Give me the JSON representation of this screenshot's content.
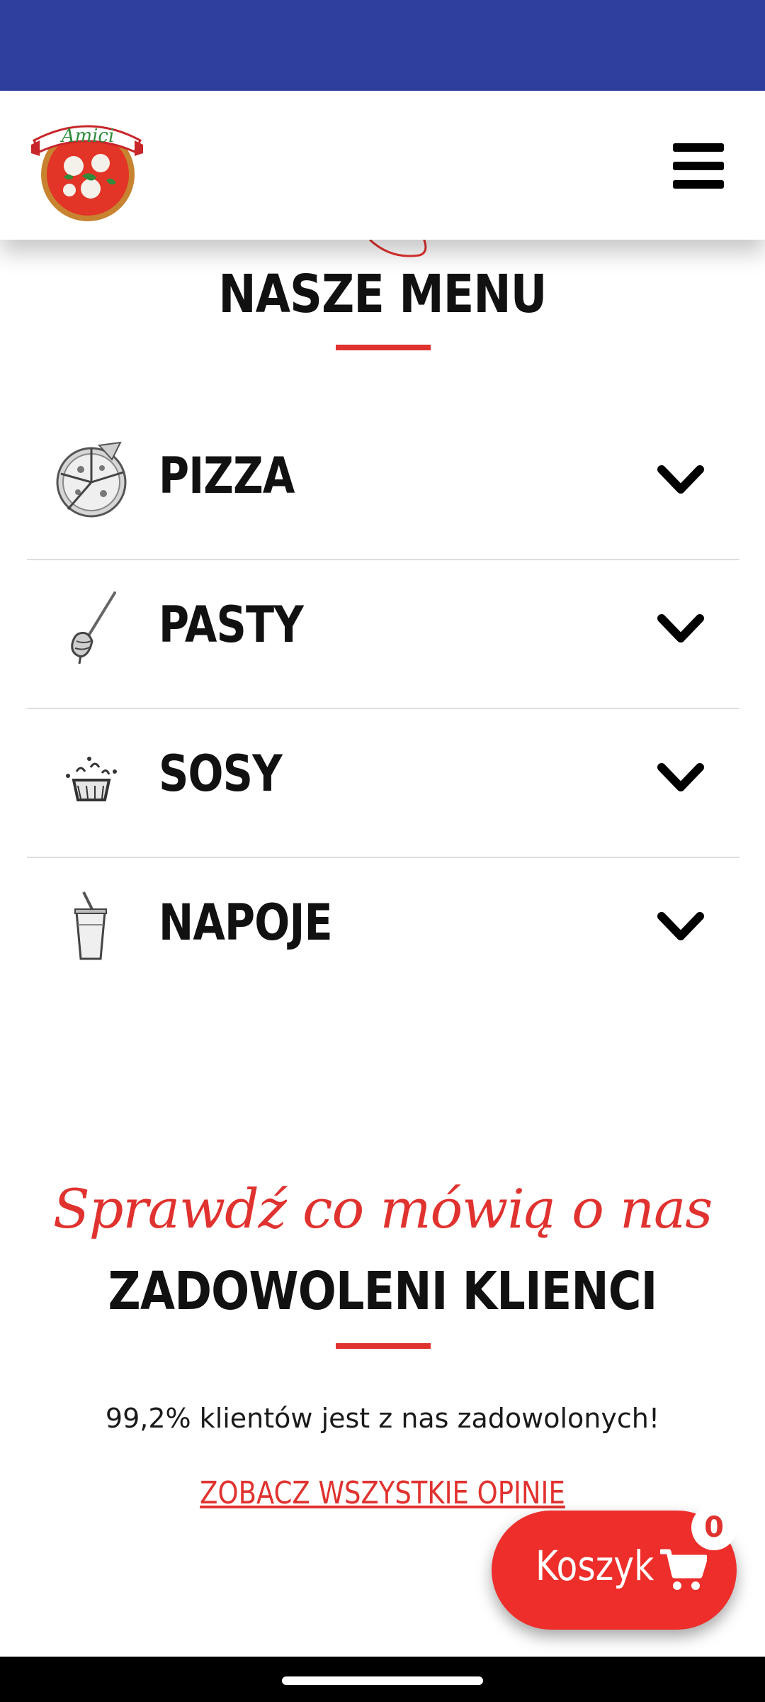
{
  "header": {
    "logo_text": "Amici"
  },
  "menu": {
    "title": "NASZE MENU",
    "items": [
      {
        "label": "PIZZA",
        "icon": "pizza-icon"
      },
      {
        "label": "PASTY",
        "icon": "pasta-fork-icon"
      },
      {
        "label": "SOSY",
        "icon": "sauce-bowl-icon"
      },
      {
        "label": "NAPOJE",
        "icon": "drink-cup-icon"
      }
    ]
  },
  "testimonials": {
    "script_title": "Sprawdź co mówią o nas",
    "title": "ZADOWOLENI KLIENCI",
    "stat": "99,2% klientów jest z nas zadowolonych!",
    "link": "ZOBACZ WSZYSTKIE OPINIE"
  },
  "cart": {
    "label": "Koszyk",
    "count": "0"
  },
  "colors": {
    "status_bar": "#2f3f9c",
    "accent": "#e0322f",
    "cart": "#ed2e2b"
  }
}
